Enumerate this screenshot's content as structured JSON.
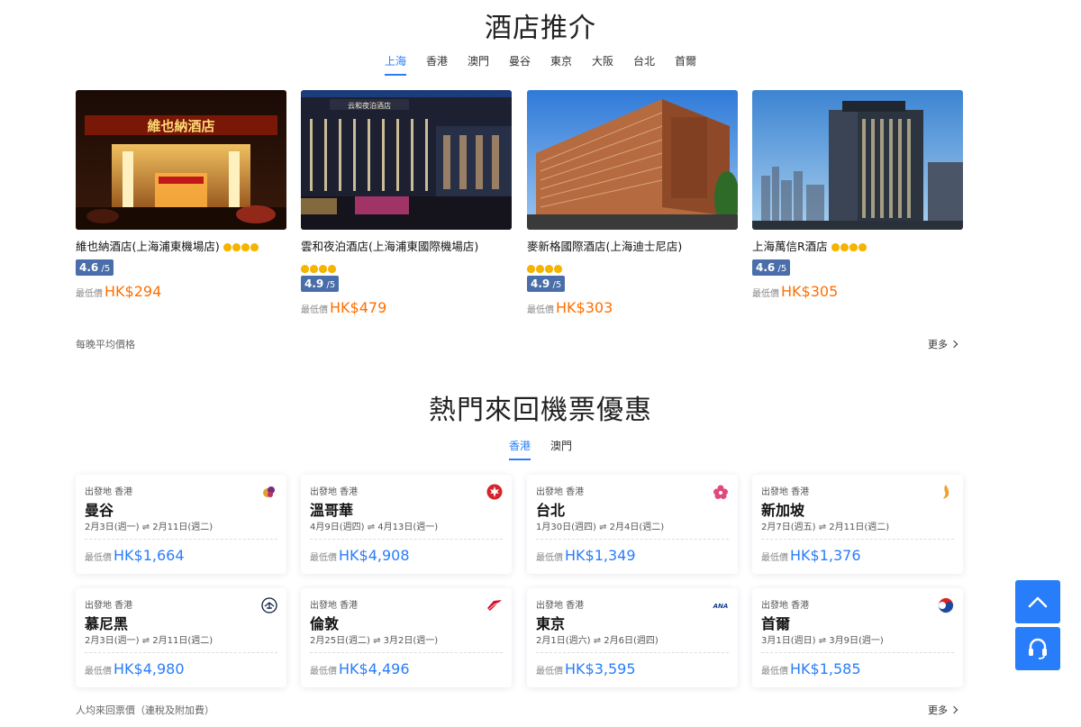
{
  "hotels": {
    "title": "酒店推介",
    "tabs": [
      "上海",
      "香港",
      "澳門",
      "曼谷",
      "東京",
      "大阪",
      "台北",
      "首爾"
    ],
    "active_tab": 0,
    "cards": [
      {
        "name": "維也納酒店(上海浦東機場店)",
        "diamonds": 4,
        "score": "4.6",
        "score_suffix": " /5",
        "price_label": "最低價",
        "price": "HK$294",
        "sign_text": "維也納酒店"
      },
      {
        "name": "雲和夜泊酒店(上海浦東國際機場店)",
        "diamonds": 4,
        "score": "4.9",
        "score_suffix": " /5",
        "price_label": "最低價",
        "price": "HK$479",
        "sign_text": "云和夜泊酒店"
      },
      {
        "name": "麥新格國際酒店(上海迪士尼店)",
        "diamonds": 4,
        "score": "4.9",
        "score_suffix": " /5",
        "price_label": "最低價",
        "price": "HK$303"
      },
      {
        "name": "上海萬信R酒店",
        "diamonds": 4,
        "score": "4.6",
        "score_suffix": " /5",
        "price_label": "最低價",
        "price": "HK$305"
      }
    ],
    "footnote": "每晚平均價格",
    "more": "更多"
  },
  "flights": {
    "title": "熱門來回機票優惠",
    "tabs": [
      "香港",
      "澳門"
    ],
    "active_tab": 0,
    "cards": [
      {
        "origin": "出發地 香港",
        "dest": "曼谷",
        "dates": "2月3日(週一) ⇌ 2月11日(週二)",
        "price_label": "最低價",
        "price": "HK$1,664",
        "logo": "thai-airways-icon"
      },
      {
        "origin": "出發地 香港",
        "dest": "溫哥華",
        "dates": "4月9日(週四) ⇌ 4月13日(週一)",
        "price_label": "最低價",
        "price": "HK$4,908",
        "logo": "air-canada-icon"
      },
      {
        "origin": "出發地 香港",
        "dest": "台北",
        "dates": "1月30日(週四) ⇌ 2月4日(週二)",
        "price_label": "最低價",
        "price": "HK$1,349",
        "logo": "china-airlines-icon"
      },
      {
        "origin": "出發地 香港",
        "dest": "新加坡",
        "dates": "2月7日(週五) ⇌ 2月11日(週二)",
        "price_label": "最低價",
        "price": "HK$1,376",
        "logo": "singapore-airlines-icon"
      },
      {
        "origin": "出發地 香港",
        "dest": "慕尼黑",
        "dates": "2月3日(週一) ⇌ 2月11日(週二)",
        "price_label": "最低價",
        "price": "HK$4,980",
        "logo": "lufthansa-icon"
      },
      {
        "origin": "出發地 香港",
        "dest": "倫敦",
        "dates": "2月25日(週二) ⇌ 3月2日(週一)",
        "price_label": "最低價",
        "price": "HK$4,496",
        "logo": "virgin-atlantic-icon"
      },
      {
        "origin": "出發地 香港",
        "dest": "東京",
        "dates": "2月1日(週六) ⇌ 2月6日(週四)",
        "price_label": "最低價",
        "price": "HK$3,595",
        "logo": "ana-icon",
        "logo_text": "ANA"
      },
      {
        "origin": "出發地 香港",
        "dest": "首爾",
        "dates": "3月1日(週日) ⇌ 3月9日(週一)",
        "price_label": "最低價",
        "price": "HK$1,585",
        "logo": "korean-air-icon"
      }
    ],
    "footnote": "人均來回票價（連稅及附加費）",
    "more": "更多"
  },
  "float": {
    "top_icon": "chevron-up-icon",
    "support_icon": "headset-icon"
  },
  "colors": {
    "accent": "#287dfa",
    "price_orange": "#ff6f00",
    "score_bg": "#4a6ea9",
    "diamond": "#f5b400"
  }
}
